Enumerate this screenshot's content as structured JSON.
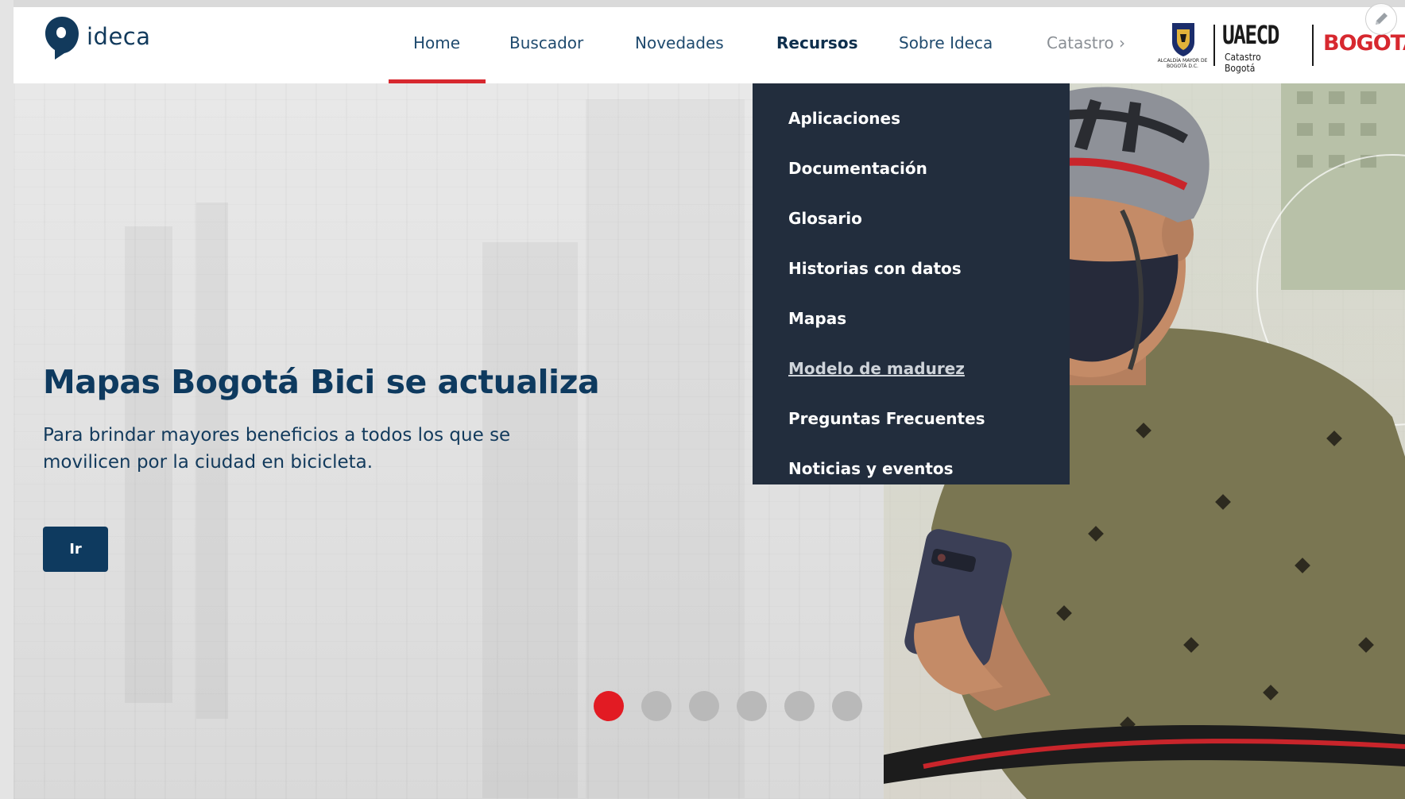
{
  "brand": {
    "name": "ideca",
    "color": "#123a5c"
  },
  "nav": {
    "items": [
      {
        "label": "Home"
      },
      {
        "label": "Buscador"
      },
      {
        "label": "Novedades"
      },
      {
        "label": "Recursos"
      },
      {
        "label": "Sobre Ideca"
      },
      {
        "label": "Catastro ›"
      }
    ],
    "active": "Home",
    "accent": "#d7282f"
  },
  "partners": {
    "escudo_caption": "ALCALDÍA MAYOR DE BOGOTÁ D.C.",
    "uaecd": "UAECD",
    "uaecd_sub": "Catastro Bogotá",
    "bogota": "BOGOTA"
  },
  "dropdown": {
    "parent": "Recursos",
    "background": "#222d3d",
    "items": [
      {
        "label": "Aplicaciones"
      },
      {
        "label": "Documentación"
      },
      {
        "label": "Glosario"
      },
      {
        "label": "Historias con datos"
      },
      {
        "label": "Mapas"
      },
      {
        "label": "Modelo de madurez"
      },
      {
        "label": "Preguntas Frecuentes"
      },
      {
        "label": "Noticias y eventos"
      }
    ],
    "hovered": "Modelo de madurez"
  },
  "hero": {
    "title": "Mapas Bogotá Bici se actualiza",
    "subtitle": "Para brindar mayores beneficios a todos los que se movilicen por la ciudad en bicicleta.",
    "button_label": "Ir",
    "slide_count": 6,
    "active_slide": 1,
    "dot_active_color": "#e21b23"
  },
  "icons": {
    "edit": "pencil-icon",
    "logo": "map-pin-head-icon"
  }
}
